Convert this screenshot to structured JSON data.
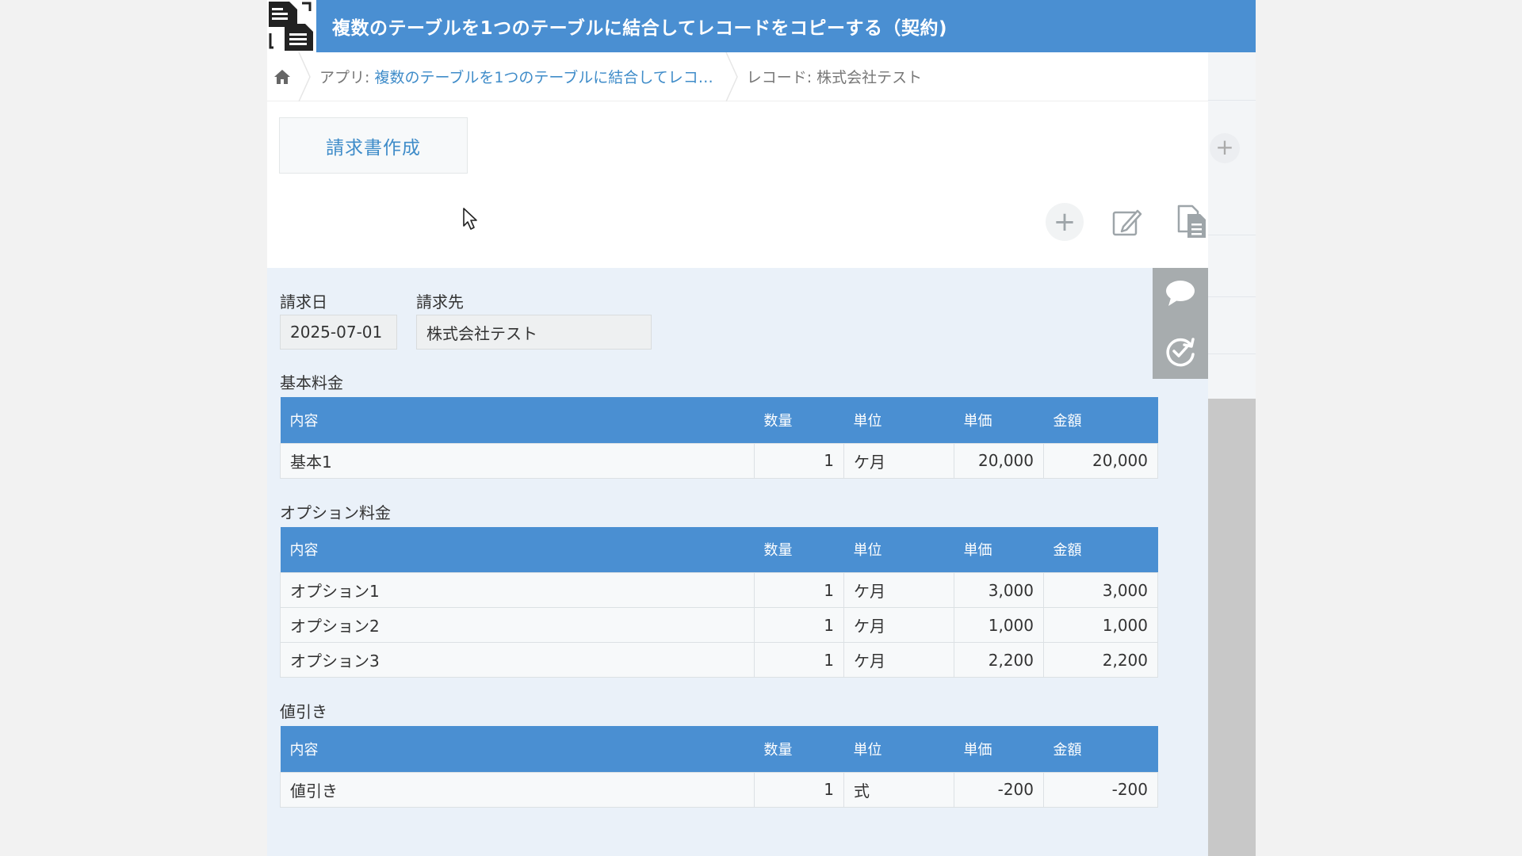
{
  "app": {
    "title": "複数のテーブルを1つのテーブルに結合してレコードをコピーする（契約)"
  },
  "breadcrumb": {
    "app_prefix": "アプリ: ",
    "app_link": "複数のテーブルを1つのテーブルに結合してレコ…",
    "record": "レコード: 株式会社テスト"
  },
  "toolbar": {
    "custom_button": "請求書作成",
    "add_symbol": "+"
  },
  "record": {
    "fields": {
      "invoice_date_label": "請求日",
      "invoice_date_value": "2025-07-01",
      "client_label": "請求先",
      "client_value": "株式会社テスト"
    },
    "columns": [
      "内容",
      "数量",
      "単位",
      "単価",
      "金額"
    ],
    "tables": [
      {
        "label": "基本料金",
        "rows": [
          [
            "基本1",
            "1",
            "ケ月",
            "20,000",
            "20,000"
          ]
        ]
      },
      {
        "label": "オプション料金",
        "rows": [
          [
            "オプション1",
            "1",
            "ケ月",
            "3,000",
            "3,000"
          ],
          [
            "オプション2",
            "1",
            "ケ月",
            "1,000",
            "1,000"
          ],
          [
            "オプション3",
            "1",
            "ケ月",
            "2,200",
            "2,200"
          ]
        ]
      },
      {
        "label": "値引き",
        "rows": [
          [
            "値引き",
            "1",
            "式",
            "-200",
            "-200"
          ]
        ]
      }
    ]
  },
  "colors": {
    "header_blue": "#4a8fd2",
    "link_blue": "#3f8cc9",
    "record_bg": "#eaf1f9"
  }
}
